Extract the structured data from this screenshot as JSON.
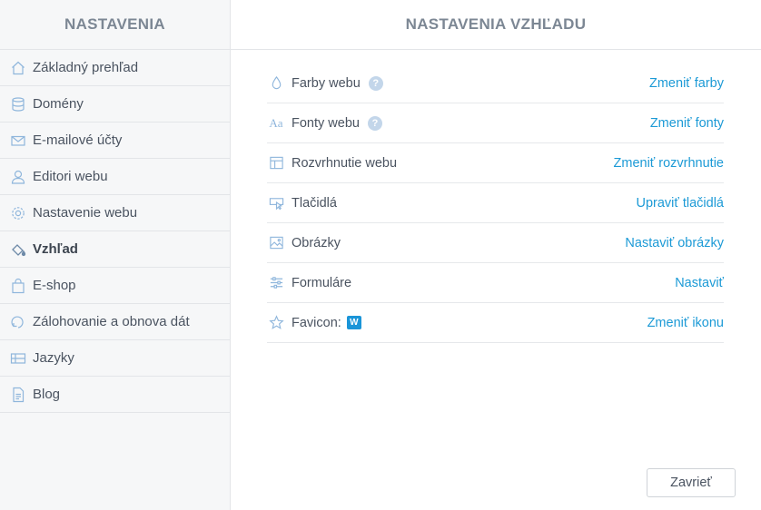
{
  "colors": {
    "accent": "#1c9ad6",
    "icon": "#8fb6dc",
    "help": "#c3d6ea",
    "badge": "#1a95d8"
  },
  "sidebar": {
    "title": "NASTAVENIA",
    "items": [
      {
        "label": "Základný prehľad",
        "icon": "home-icon",
        "active": false
      },
      {
        "label": "Domény",
        "icon": "database-icon",
        "active": false
      },
      {
        "label": "E-mailové účty",
        "icon": "envelope-icon",
        "active": false
      },
      {
        "label": "Editori webu",
        "icon": "user-icon",
        "active": false
      },
      {
        "label": "Nastavenie webu",
        "icon": "gear-icon",
        "active": false
      },
      {
        "label": "Vzhľad",
        "icon": "paint-bucket-icon",
        "active": true
      },
      {
        "label": "E-shop",
        "icon": "shopping-bag-icon",
        "active": false
      },
      {
        "label": "Zálohovanie a obnova dát",
        "icon": "backup-icon",
        "active": false
      },
      {
        "label": "Jazyky",
        "icon": "flag-icon",
        "active": false
      },
      {
        "label": "Blog",
        "icon": "document-icon",
        "active": false
      }
    ]
  },
  "main": {
    "title": "NASTAVENIA VZHĽADU",
    "rows": [
      {
        "label": "Farby webu",
        "icon": "droplet-icon",
        "help": "?",
        "action": "Zmeniť farby"
      },
      {
        "label": "Fonty webu",
        "icon": "font-icon",
        "icon_text": "Aa",
        "help": "?",
        "action": "Zmeniť fonty"
      },
      {
        "label": "Rozvrhnutie webu",
        "icon": "layout-icon",
        "action": "Zmeniť rozvrhnutie"
      },
      {
        "label": "Tlačidlá",
        "icon": "button-cursor-icon",
        "action": "Upraviť tlačidlá"
      },
      {
        "label": "Obrázky",
        "icon": "image-icon",
        "action": "Nastaviť obrázky"
      },
      {
        "label": "Formuláre",
        "icon": "sliders-icon",
        "action": "Nastaviť"
      },
      {
        "label": "Favicon:",
        "icon": "star-icon",
        "badge": "W",
        "action": "Zmeniť ikonu"
      }
    ],
    "close_label": "Zavrieť"
  }
}
